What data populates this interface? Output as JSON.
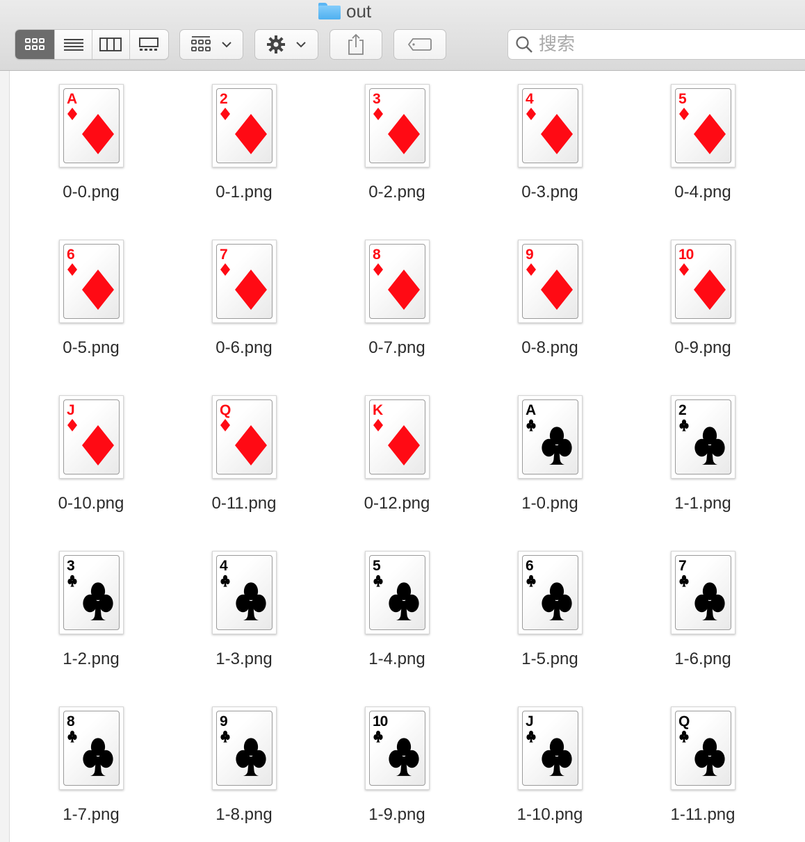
{
  "window": {
    "title": "out"
  },
  "toolbar": {
    "search_placeholder": "搜索"
  },
  "colors": {
    "red": "#ff0a14",
    "black": "#000000"
  },
  "files": [
    {
      "name": "0-0.png",
      "rank": "A",
      "suit": "diamond"
    },
    {
      "name": "0-1.png",
      "rank": "2",
      "suit": "diamond"
    },
    {
      "name": "0-2.png",
      "rank": "3",
      "suit": "diamond"
    },
    {
      "name": "0-3.png",
      "rank": "4",
      "suit": "diamond"
    },
    {
      "name": "0-4.png",
      "rank": "5",
      "suit": "diamond"
    },
    {
      "name": "0-5.png",
      "rank": "6",
      "suit": "diamond"
    },
    {
      "name": "0-6.png",
      "rank": "7",
      "suit": "diamond"
    },
    {
      "name": "0-7.png",
      "rank": "8",
      "suit": "diamond"
    },
    {
      "name": "0-8.png",
      "rank": "9",
      "suit": "diamond"
    },
    {
      "name": "0-9.png",
      "rank": "10",
      "suit": "diamond"
    },
    {
      "name": "0-10.png",
      "rank": "J",
      "suit": "diamond"
    },
    {
      "name": "0-11.png",
      "rank": "Q",
      "suit": "diamond"
    },
    {
      "name": "0-12.png",
      "rank": "K",
      "suit": "diamond"
    },
    {
      "name": "1-0.png",
      "rank": "A",
      "suit": "club"
    },
    {
      "name": "1-1.png",
      "rank": "2",
      "suit": "club"
    },
    {
      "name": "1-2.png",
      "rank": "3",
      "suit": "club"
    },
    {
      "name": "1-3.png",
      "rank": "4",
      "suit": "club"
    },
    {
      "name": "1-4.png",
      "rank": "5",
      "suit": "club"
    },
    {
      "name": "1-5.png",
      "rank": "6",
      "suit": "club"
    },
    {
      "name": "1-6.png",
      "rank": "7",
      "suit": "club"
    },
    {
      "name": "1-7.png",
      "rank": "8",
      "suit": "club"
    },
    {
      "name": "1-8.png",
      "rank": "9",
      "suit": "club"
    },
    {
      "name": "1-9.png",
      "rank": "10",
      "suit": "club"
    },
    {
      "name": "1-10.png",
      "rank": "J",
      "suit": "club"
    },
    {
      "name": "1-11.png",
      "rank": "Q",
      "suit": "club"
    }
  ]
}
